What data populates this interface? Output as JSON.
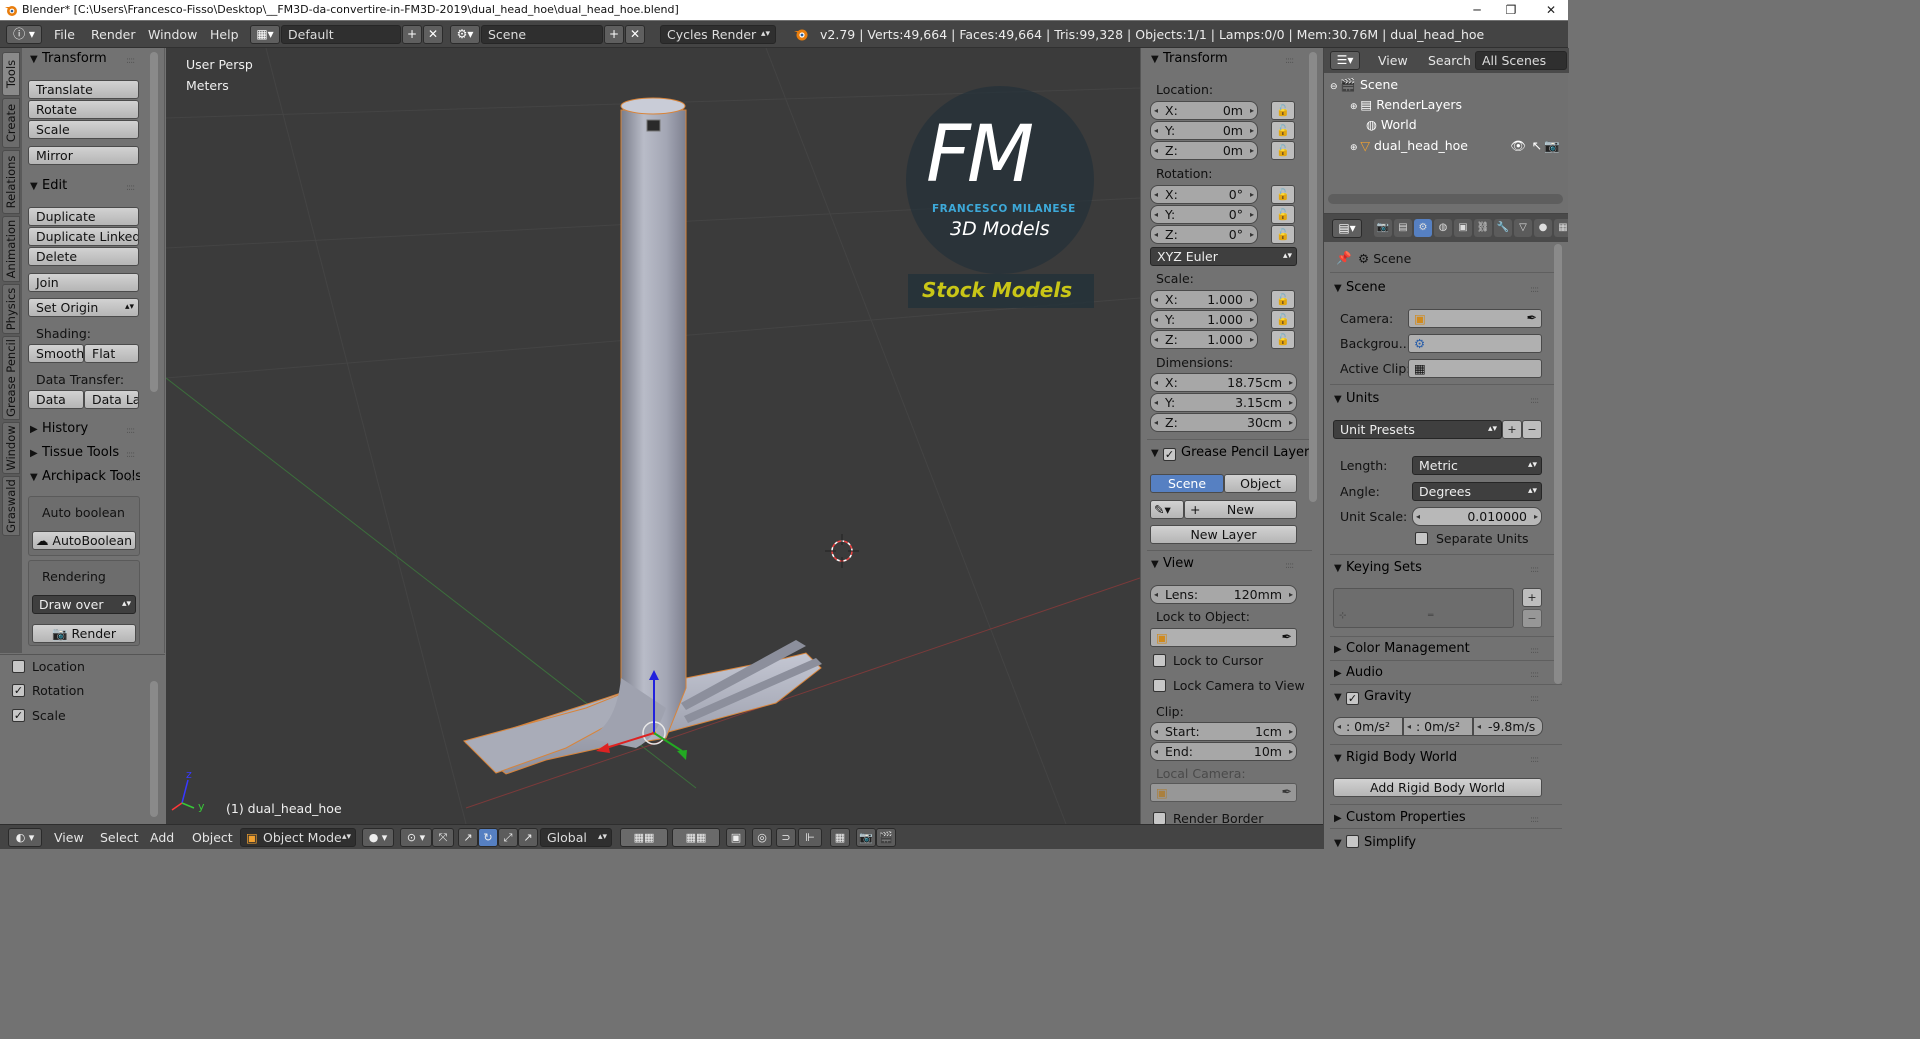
{
  "window": {
    "title": "Blender* [C:\\Users\\Francesco-Fisso\\Desktop\\__FM3D-da-convertire-in-FM3D-2019\\dual_head_hoe\\dual_head_hoe.blend]",
    "minimize": "─",
    "maximize": "❐",
    "close": "✕"
  },
  "topbar": {
    "menus": [
      "File",
      "Render",
      "Window",
      "Help"
    ],
    "layout": "Default",
    "scene": "Scene",
    "engine": "Cycles Render",
    "info": "v2.79 | Verts:49,664 | Faces:49,664 | Tris:99,328 | Objects:1/1 | Lamps:0/0 | Mem:30.76M | dual_head_hoe"
  },
  "left_tabs": [
    "Tools",
    "Create",
    "Relations",
    "Animation",
    "Physics",
    "Grease Pencil",
    "Window",
    "Graswald"
  ],
  "toolshelf": {
    "transform": {
      "title": "Transform",
      "buttons": [
        "Translate",
        "Rotate",
        "Scale"
      ],
      "mirror": "Mirror"
    },
    "edit": {
      "title": "Edit",
      "buttons": [
        "Duplicate",
        "Duplicate Linked",
        "Delete"
      ],
      "join": "Join",
      "set_origin": "Set Origin"
    },
    "shading": {
      "label": "Shading:",
      "smooth": "Smooth",
      "flat": "Flat"
    },
    "data_transfer": {
      "label": "Data Transfer:",
      "data": "Data",
      "data_la": "Data La"
    },
    "history": "History",
    "tissue": "Tissue Tools",
    "archipack": {
      "title": "Archipack Tools",
      "auto_boolean_label": "Auto boolean",
      "auto_boolean_btn": "AutoBoolean",
      "rendering_label": "Rendering",
      "draw_over": "Draw over",
      "render": "Render"
    }
  },
  "redo_panel": {
    "location": "Location",
    "rotation": "Rotation",
    "scale": "Scale"
  },
  "viewport": {
    "view_label": "User Persp",
    "units_label": "Meters",
    "object_label": "(1) dual_head_hoe",
    "watermark_initials": "FM",
    "watermark_name": "FRANCESCO MILANESE",
    "watermark_sub": "3D Models",
    "watermark_stock": "Stock Models"
  },
  "npanel": {
    "transform_title": "Transform",
    "location_label": "Location:",
    "location": [
      {
        "axis": "X:",
        "value": "0m"
      },
      {
        "axis": "Y:",
        "value": "0m"
      },
      {
        "axis": "Z:",
        "value": "0m"
      }
    ],
    "rotation_label": "Rotation:",
    "rotation": [
      {
        "axis": "X:",
        "value": "0°"
      },
      {
        "axis": "Y:",
        "value": "0°"
      },
      {
        "axis": "Z:",
        "value": "0°"
      }
    ],
    "rotation_mode": "XYZ Euler",
    "scale_label": "Scale:",
    "scale": [
      {
        "axis": "X:",
        "value": "1.000"
      },
      {
        "axis": "Y:",
        "value": "1.000"
      },
      {
        "axis": "Z:",
        "value": "1.000"
      }
    ],
    "dimensions_label": "Dimensions:",
    "dimensions": [
      {
        "axis": "X:",
        "value": "18.75cm"
      },
      {
        "axis": "Y:",
        "value": "3.15cm"
      },
      {
        "axis": "Z:",
        "value": "30cm"
      }
    ],
    "grease_title": "Grease Pencil Layer",
    "gp_scene": "Scene",
    "gp_object": "Object",
    "gp_new": "New",
    "gp_new_layer": "New Layer",
    "view_title": "View",
    "lens_label": "Lens:",
    "lens_value": "120mm",
    "lock_to_object": "Lock to Object:",
    "lock_to_cursor": "Lock to Cursor",
    "lock_camera": "Lock Camera to View",
    "clip_label": "Clip:",
    "clip_start_label": "Start:",
    "clip_start": "1cm",
    "clip_end_label": "End:",
    "clip_end": "10m",
    "local_camera": "Local Camera:",
    "render_border": "Render Border"
  },
  "outliner": {
    "view": "View",
    "search": "Search",
    "all_scenes": "All Scenes",
    "items": [
      "Scene",
      "RenderLayers",
      "World",
      "dual_head_hoe"
    ]
  },
  "properties": {
    "context": "Scene",
    "scene_section": "Scene",
    "camera_label": "Camera:",
    "background_label": "Backgrou...",
    "active_clip_label": "Active Clip:",
    "units_section": "Units",
    "unit_presets": "Unit Presets",
    "length_label": "Length:",
    "length_value": "Metric",
    "angle_label": "Angle:",
    "angle_value": "Degrees",
    "unit_scale_label": "Unit Scale:",
    "unit_scale_value": "0.010000",
    "separate_units": "Separate Units",
    "keying_sets": "Keying Sets",
    "color_management": "Color Management",
    "audio": "Audio",
    "gravity": "Gravity",
    "gravity_x": ": 0m/s²",
    "gravity_y": ": 0m/s²",
    "gravity_z": "-9.8m/s",
    "rigid_body_world": "Rigid Body World",
    "add_rigid_body": "Add Rigid Body World",
    "custom_properties": "Custom Properties",
    "simplify": "Simplify"
  },
  "bottombar": {
    "menus": [
      "View",
      "Select",
      "Add",
      "Object"
    ],
    "mode": "Object Mode",
    "orientation": "Global"
  },
  "colors": {
    "selected_blue": "#5680c2",
    "watermark_blue": "#3da9d9",
    "watermark_yellow": "#c9c617",
    "viewport_bg": "#3b3b3b",
    "panel_bg": "#727272"
  }
}
